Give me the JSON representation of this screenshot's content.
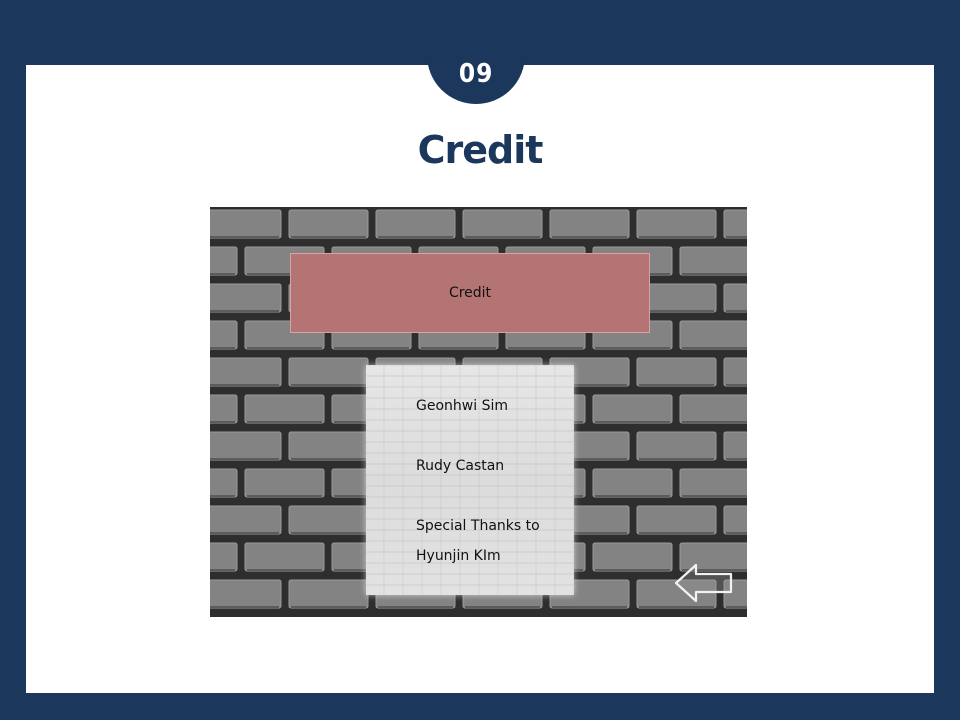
{
  "slide": {
    "number": "09",
    "title": "Credit"
  },
  "game_screen": {
    "banner_label": "Credit",
    "credits": {
      "line1": "Geonhwi Sim",
      "line2": "Rudy Castan",
      "line3": "Special Thanks to",
      "line4": "Hyunjin KIm"
    },
    "back_icon": "left-arrow-icon"
  },
  "colors": {
    "frame": "#1b375c",
    "slide_background": "#ffffff",
    "title": "#1b375c",
    "banner": "#b47474",
    "brick": "#838383",
    "mortar": "#2e2e2e"
  }
}
